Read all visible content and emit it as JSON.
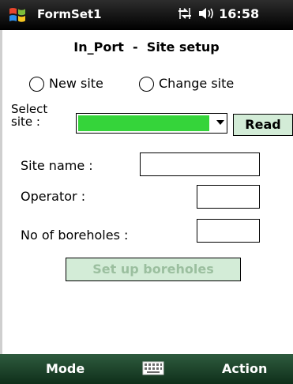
{
  "status_bar": {
    "app_title": "FormSet1",
    "time": "16:58",
    "icons": [
      "windows-start-icon",
      "connectivity-icon",
      "volume-icon"
    ]
  },
  "page": {
    "title": "In_Port  -  Site setup"
  },
  "site_mode": {
    "options": [
      {
        "label": "New site",
        "selected": false
      },
      {
        "label": "Change site",
        "selected": false
      }
    ]
  },
  "select_site": {
    "label_line1": "Select",
    "label_line2": "site :",
    "selected_value": "",
    "highlight_color": "#35d43a",
    "read_label": "Read"
  },
  "form": {
    "site_name_label": "Site name :",
    "site_name_value": "",
    "operator_label": "Operator :",
    "operator_value": "",
    "boreholes_label": "No of boreholes :",
    "boreholes_value": "",
    "setup_button_label": "Set up boreholes",
    "setup_button_enabled": false
  },
  "soft_keys": {
    "left": "Mode",
    "right": "Action",
    "center_icon": "keyboard-icon"
  },
  "colors": {
    "button_fill": "#d3ecd7",
    "disabled_text": "#9bbf9f",
    "softkey_bar": "#1f4a2e"
  }
}
